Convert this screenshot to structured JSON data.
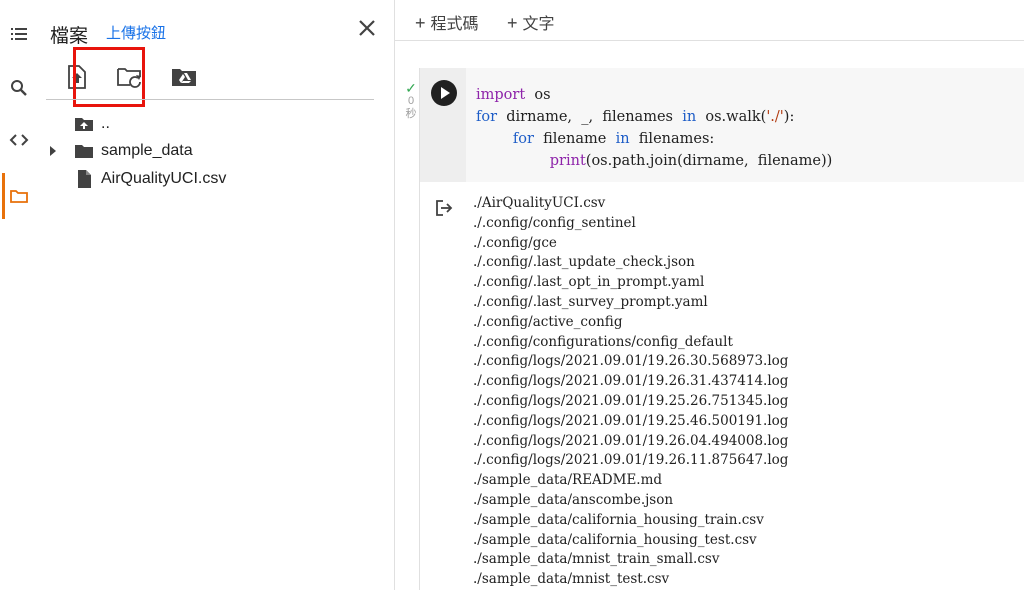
{
  "panel": {
    "title": "檔案",
    "subtitle": "上傳按鈕",
    "tree": [
      {
        "label": "..",
        "icon": "folder-up-icon"
      },
      {
        "label": "sample_data",
        "icon": "folder-icon",
        "expandable": true
      },
      {
        "label": "AirQualityUCI.csv",
        "icon": "file-icon"
      }
    ]
  },
  "toolbar": {
    "add_code": "程式碼",
    "add_text": "文字"
  },
  "cell": {
    "status_time": "0",
    "status_unit": "秒"
  },
  "code": {
    "l1_kw": "import",
    "l1_mod": "os",
    "l2_for": "for",
    "l2_vars": "dirname,  _,  filenames",
    "l2_in": "in",
    "l2_call": "os.walk(",
    "l2_str": "'./'",
    "l2_end": "):",
    "l3_for": "for",
    "l3_var": "filename",
    "l3_in": "in",
    "l3_iter": "filenames:",
    "l4_print": "print",
    "l4_args": "(os.path.join(dirname,  filename))"
  },
  "output": [
    "./AirQualityUCI.csv",
    "./.config/config_sentinel",
    "./.config/gce",
    "./.config/.last_update_check.json",
    "./.config/.last_opt_in_prompt.yaml",
    "./.config/.last_survey_prompt.yaml",
    "./.config/active_config",
    "./.config/configurations/config_default",
    "./.config/logs/2021.09.01/19.26.30.568973.log",
    "./.config/logs/2021.09.01/19.26.31.437414.log",
    "./.config/logs/2021.09.01/19.25.26.751345.log",
    "./.config/logs/2021.09.01/19.25.46.500191.log",
    "./.config/logs/2021.09.01/19.26.04.494008.log",
    "./.config/logs/2021.09.01/19.26.11.875647.log",
    "./sample_data/README.md",
    "./sample_data/anscombe.json",
    "./sample_data/california_housing_train.csv",
    "./sample_data/california_housing_test.csv",
    "./sample_data/mnist_train_small.csv",
    "./sample_data/mnist_test.csv"
  ],
  "colors": {
    "accent": "#e8710a",
    "highlight": "#e8140c",
    "link": "#1a73e8",
    "success": "#34a853"
  }
}
